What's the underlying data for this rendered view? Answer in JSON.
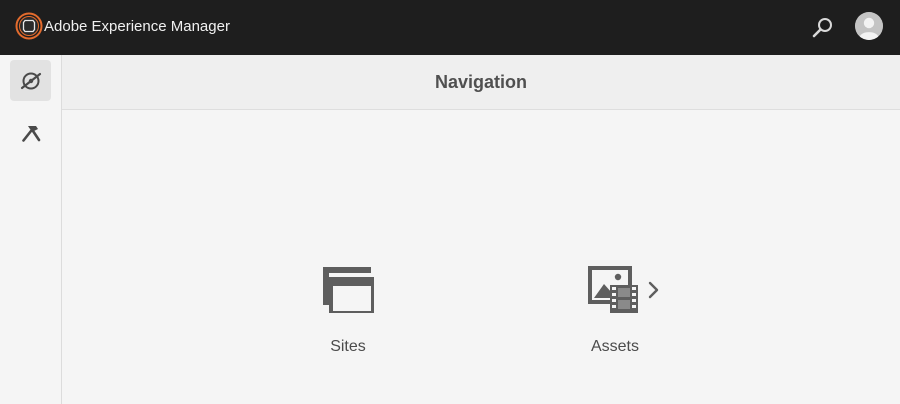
{
  "app": {
    "title": "Adobe Experience Manager"
  },
  "topbar": {
    "logo_icon": "aem-logo-icon",
    "search_icon": "search-icon",
    "avatar_icon": "user-avatar-icon"
  },
  "rail": {
    "items": [
      {
        "icon": "navigation-compass-icon",
        "active": true
      },
      {
        "icon": "hammer-tools-icon",
        "active": false
      }
    ]
  },
  "header": {
    "title": "Navigation"
  },
  "tiles": [
    {
      "label": "Sites",
      "icon": "sites-windows-icon",
      "has_children": false
    },
    {
      "label": "Assets",
      "icon": "assets-image-film-icon",
      "has_children": true
    }
  ],
  "colors": {
    "topbar_bg": "#1e1e1e",
    "logo_accent": "#e36b2d",
    "icon_gray": "#5e5e5e",
    "page_bg": "#f5f5f5",
    "header_bg": "#efefef"
  }
}
